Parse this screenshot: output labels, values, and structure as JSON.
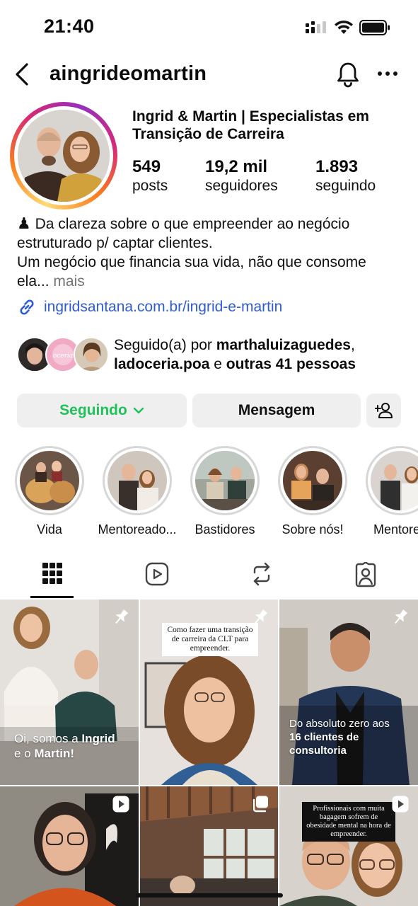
{
  "status_bar": {
    "time": "21:40"
  },
  "header": {
    "username": "aingrideomartin"
  },
  "profile": {
    "full_name": "Ingrid & Martin | Especialistas em Transição de Carreira",
    "stats": [
      {
        "value": "549",
        "label": "posts"
      },
      {
        "value": "19,2 mil",
        "label": "seguidores"
      },
      {
        "value": "1.893",
        "label": "seguindo"
      }
    ],
    "bio_icon": "♟",
    "bio_line1": "Da clareza sobre o que empreender ao negócio estruturado p/ captar clientes.",
    "bio_line2": "Um negócio que financia sua vida, não que consome ela...",
    "bio_more": "mais",
    "link": "ingridsantana.com.br/ingrid-e-martin",
    "followed_by": {
      "prefix": "Seguido(a) por",
      "user1": "marthaluizaguedes",
      "comma": ",",
      "user2": "ladoceria.poa",
      "conj": "e",
      "others": "outras 41 pessoas"
    }
  },
  "buttons": {
    "following": "Seguindo",
    "message": "Mensagem"
  },
  "highlights": [
    {
      "label": "Vida"
    },
    {
      "label": "Mentoreado..."
    },
    {
      "label": "Bastidores"
    },
    {
      "label": "Sobre nós!"
    },
    {
      "label": "Mentorea"
    }
  ],
  "tabs": [
    "grid",
    "reels",
    "reposts",
    "tagged"
  ],
  "posts": [
    {
      "caption_pre": "Oi, somos a ",
      "caption_b1": "Ingrid",
      "caption_mid": "e o ",
      "caption_b2": "Martin!",
      "badge": "pin-icon"
    },
    {
      "note": "Como fazer uma transição de carreira da CLT para empreender.",
      "badge": "pin-icon"
    },
    {
      "caption_line1": "Do absoluto zero aos",
      "caption_line2": "16 clientes de consultoria",
      "badge": "pin-icon"
    },
    {
      "badge": "reel-icon"
    },
    {
      "badge": "carousel-icon"
    },
    {
      "note": "Profissionais com muita bagagem sofrem de obesidade mental na hora de empreender.",
      "badge": "reel-icon"
    }
  ],
  "colors": {
    "following_green": "#20c15b",
    "link_blue": "#2f5bd3",
    "button_bg": "#efefef"
  }
}
